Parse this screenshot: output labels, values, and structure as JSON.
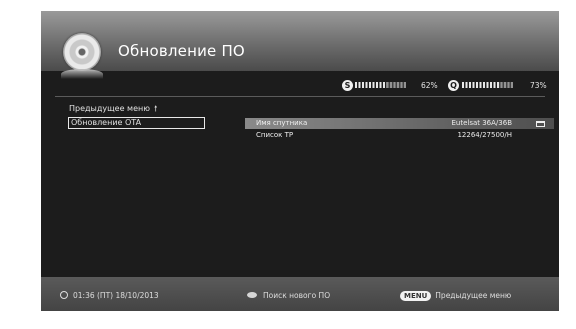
{
  "header": {
    "title": "Обновление ПО",
    "disc_icon": "disc-icon"
  },
  "signal": {
    "strength_icon": "S",
    "strength_percent": "62%",
    "strength_level": 0.62,
    "quality_icon": "Q",
    "quality_percent": "73%",
    "quality_level": 0.73
  },
  "menu": {
    "items": [
      {
        "label": "Предыдущее меню",
        "icon": "arrow-up-icon",
        "arrow": "🠕"
      },
      {
        "label": "Обновление OTA",
        "selected": true
      }
    ]
  },
  "settings": {
    "rows": [
      {
        "label": "Имя спутника",
        "value": "Eutelsat 36A/36B",
        "active": true
      },
      {
        "label": "Список TP",
        "value": "12264/27500/H"
      }
    ]
  },
  "footer": {
    "datetime": "01:36 (ПТ) 18/10/2013",
    "search_label": "Поиск нового ПО",
    "menu_key": "MENU",
    "previous_menu_label": "Предыдущее меню"
  }
}
